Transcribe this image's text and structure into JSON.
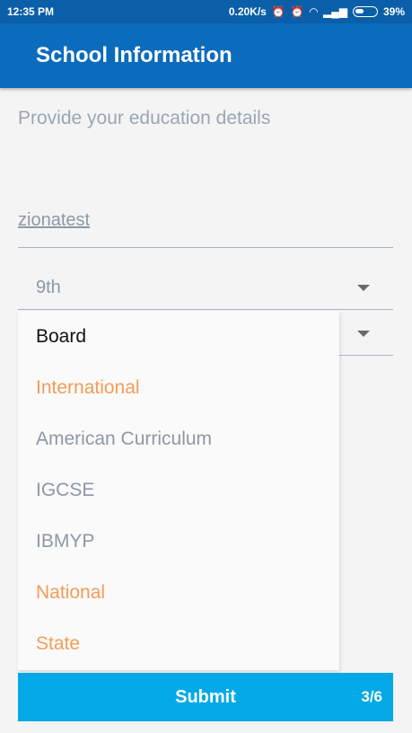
{
  "status_bar": {
    "time": "12:35 PM",
    "speed": "0.20K/s",
    "battery": "39%",
    "icons": [
      "alarm-off-icon",
      "alarm-icon",
      "wifi-icon",
      "signal-icon",
      "battery-icon"
    ]
  },
  "app_bar": {
    "title": "School Information"
  },
  "form": {
    "subtitle": "Provide your education details",
    "school_field": {
      "value": "zionatest"
    },
    "grade_dropdown": {
      "value": "9th"
    }
  },
  "popup": {
    "header": "Board",
    "items": [
      {
        "label": "International",
        "kind": "category"
      },
      {
        "label": "American Curriculum",
        "kind": "option"
      },
      {
        "label": "IGCSE",
        "kind": "option"
      },
      {
        "label": "IBMYP",
        "kind": "option"
      },
      {
        "label": "National",
        "kind": "category"
      },
      {
        "label": "State",
        "kind": "category"
      }
    ]
  },
  "footer": {
    "submit_label": "Submit",
    "step": "3/6"
  },
  "colors": {
    "status_bar": "#0a5fa8",
    "app_bar": "#0b6bbd",
    "accent_orange": "#f59c57",
    "submit": "#03a9e6",
    "muted_text": "#8d98a6"
  }
}
